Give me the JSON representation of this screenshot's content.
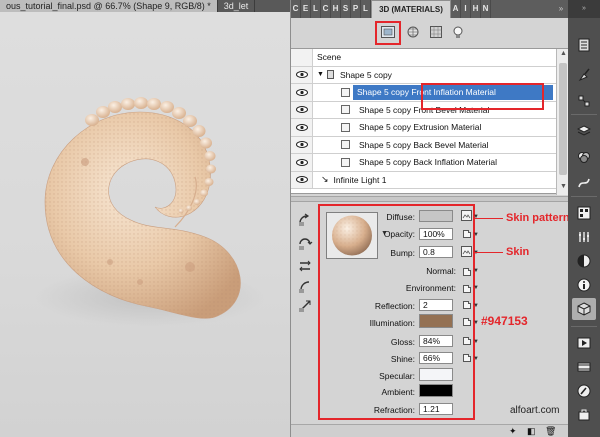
{
  "document_tabs": [
    "ous_tutorial_final.psd @ 66.7% (Shape 9, RGB/8) *",
    "3d_let"
  ],
  "panel": {
    "collapsed_tab_letters": [
      "C",
      "E",
      "L",
      "C",
      "H",
      "S",
      "P",
      "L",
      "A",
      "I",
      "H",
      "N"
    ],
    "active_tab": "3D (MATERIALS)",
    "collapse_glyph": "»",
    "menu_glyph": "≡"
  },
  "view_buttons": [
    "scene-filter-icon",
    "mesh-filter-icon",
    "materials-filter-icon",
    "lights-filter-icon"
  ],
  "scene_tree": {
    "rows": [
      {
        "label": "Scene",
        "level": 0,
        "eye": false,
        "type": "header"
      },
      {
        "label": "Shape 5 copy",
        "level": 1,
        "eye": true,
        "type": "mesh"
      },
      {
        "label": "Shape 5 copy Front Inflation Material",
        "level": 2,
        "eye": true,
        "type": "material",
        "selected": true
      },
      {
        "label": "Shape 5 copy Front Bevel Material",
        "level": 2,
        "eye": true,
        "type": "material"
      },
      {
        "label": "Shape 5 copy Extrusion Material",
        "level": 2,
        "eye": true,
        "type": "material"
      },
      {
        "label": "Shape 5 copy Back Bevel Material",
        "level": 2,
        "eye": true,
        "type": "material"
      },
      {
        "label": "Shape 5 copy Back Inflation Material",
        "level": 2,
        "eye": true,
        "type": "material"
      },
      {
        "label": "Infinite Light 1",
        "level": 1,
        "eye": true,
        "type": "light"
      }
    ]
  },
  "material": {
    "diffuse_label": "Diffuse:",
    "diffuse_color": "#c6c6c6",
    "opacity_label": "Opacity:",
    "opacity_value": "100%",
    "bump_label": "Bump:",
    "bump_value": "0.8",
    "normal_label": "Normal:",
    "environment_label": "Environment:",
    "reflection_label": "Reflection:",
    "reflection_value": "2",
    "illumination_label": "Illumination:",
    "illumination_color": "#947153",
    "gloss_label": "Gloss:",
    "gloss_value": "84%",
    "shine_label": "Shine:",
    "shine_value": "66%",
    "specular_label": "Specular:",
    "specular_color": "#f4f5f8",
    "ambient_label": "Ambient:",
    "ambient_color": "#000000",
    "refraction_label": "Refraction:",
    "refraction_value": "1.21"
  },
  "annotations": {
    "skin_pattern": "Skin pattern",
    "skin": "Skin",
    "color_code": "#947153"
  },
  "dock_icons": [
    "history-icon",
    "brush-icon",
    "layers-icon",
    "channels-icon",
    "paths-icon",
    "swatches-icon",
    "adjustments-icon",
    "masks-icon",
    "info-icon",
    "3d-icon",
    "actions-icon",
    "animation-icon",
    "navigator-icon",
    "clone-source-icon"
  ],
  "watermark": "alfoart.com"
}
